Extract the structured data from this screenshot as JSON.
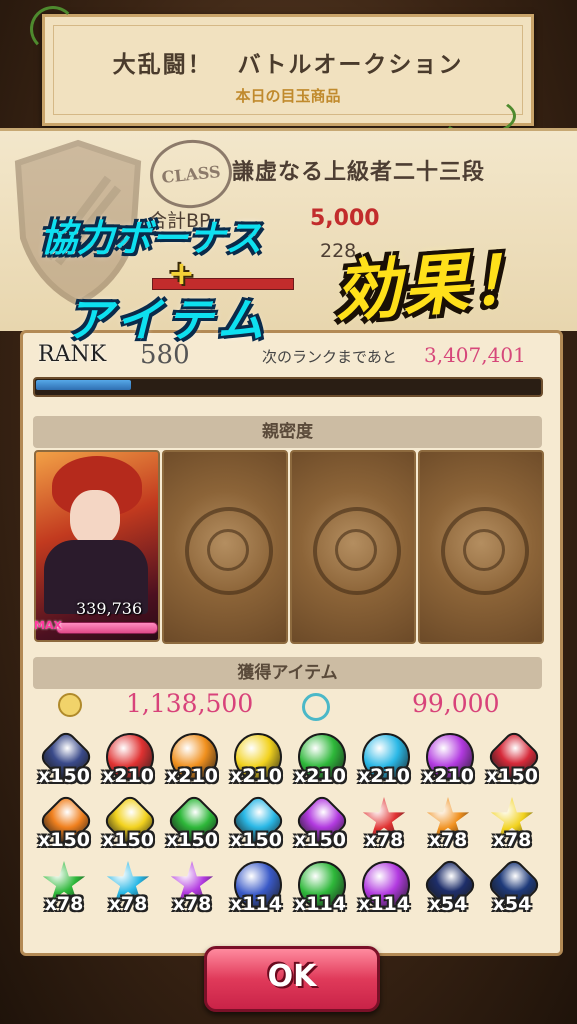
{
  "banner": {
    "title": "大乱闘！　バトルオークション",
    "subtitle": "本日の目玉商品"
  },
  "class_section": {
    "stamp": "CLASS",
    "class_name": "謙虚なる上級者二十三段",
    "bp_label": "合計BP",
    "bp_value": "5,000",
    "bp_secondary": "228"
  },
  "overlay": {
    "line1": "協力ボーナス",
    "plus": "+",
    "line2": "アイテム",
    "effect": "効果！"
  },
  "rank": {
    "label": "RANK",
    "value": "580",
    "next_label": "次のランクまであと",
    "next_value": "3,407,401",
    "progress": 0.19
  },
  "intimacy": {
    "header": "親密度",
    "character_value": "339,736",
    "max_label": "MAX"
  },
  "items": {
    "header": "獲得アイテム",
    "coin_value": "1,138,500",
    "soul_value": "99,000",
    "grid": [
      {
        "shape": "hex",
        "color": "#3a4a8a",
        "qty": "x150"
      },
      {
        "shape": "round",
        "color": "#e03232",
        "qty": "x210"
      },
      {
        "shape": "round",
        "color": "#f0901e",
        "qty": "x210"
      },
      {
        "shape": "round",
        "color": "#f2d21e",
        "qty": "x210"
      },
      {
        "shape": "round",
        "color": "#2eb83a",
        "qty": "x210"
      },
      {
        "shape": "round",
        "color": "#2ab8e6",
        "qty": "x210"
      },
      {
        "shape": "round",
        "color": "#b23ae0",
        "qty": "x210"
      },
      {
        "shape": "hex",
        "color": "#d62a3a",
        "qty": "x150"
      },
      {
        "shape": "hex",
        "color": "#f0801e",
        "qty": "x150"
      },
      {
        "shape": "hex",
        "color": "#f2d21e",
        "qty": "x150"
      },
      {
        "shape": "hex",
        "color": "#2eb83a",
        "qty": "x150"
      },
      {
        "shape": "hex",
        "color": "#2ab8e6",
        "qty": "x150"
      },
      {
        "shape": "hex",
        "color": "#b23ae0",
        "qty": "x150"
      },
      {
        "shape": "star",
        "color": "#e03232",
        "qty": "x78"
      },
      {
        "shape": "star",
        "color": "#f0901e",
        "qty": "x78"
      },
      {
        "shape": "star",
        "color": "#f2d21e",
        "qty": "x78"
      },
      {
        "shape": "star",
        "color": "#2eb83a",
        "qty": "x78"
      },
      {
        "shape": "star",
        "color": "#2ab8e6",
        "qty": "x78"
      },
      {
        "shape": "star",
        "color": "#b23ae0",
        "qty": "x78"
      },
      {
        "shape": "orb",
        "color": "#3a5ac8",
        "qty": "x114"
      },
      {
        "shape": "orb",
        "color": "#2eb83a",
        "qty": "x114"
      },
      {
        "shape": "orb",
        "color": "#b23ae0",
        "qty": "x114"
      },
      {
        "shape": "hex",
        "color": "#1e2e6a",
        "qty": "x54"
      },
      {
        "shape": "hex",
        "color": "#1e3a7a",
        "qty": "x54"
      }
    ]
  },
  "ok_button": {
    "label": "OK"
  }
}
